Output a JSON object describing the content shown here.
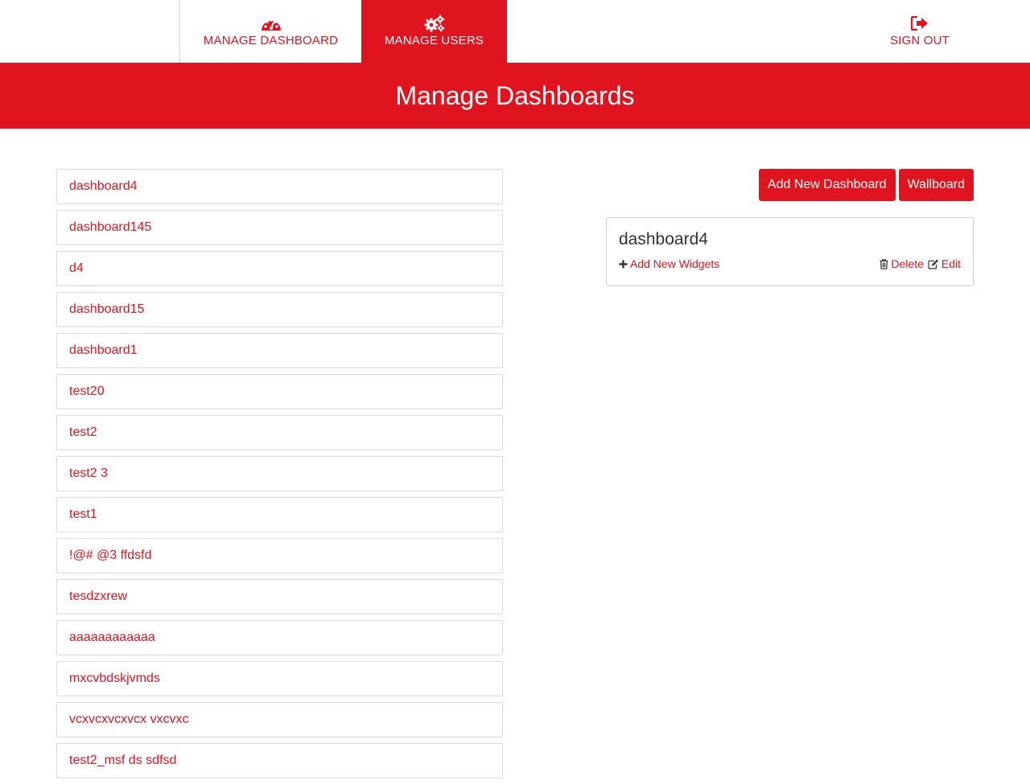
{
  "nav": {
    "manage_dashboard": "MANAGE DASHBOARD",
    "manage_users": "MANAGE USERS",
    "sign_out": "SIGN OUT"
  },
  "banner": {
    "title": "Manage Dashboards"
  },
  "dashboards": [
    "dashboard4",
    "dashboard145",
    "d4",
    "dashboard15",
    "dashboard1",
    "test20",
    "test2",
    "test2 3",
    "test1",
    "!@# @3 ffdsfd",
    "tesdzxrew",
    "aaaaaaaaaaaa",
    "mxcvbdskjvmds",
    "vcxvcxvcxvcx vxcvxc",
    "test2_msf ds sdfsd"
  ],
  "buttons": {
    "add_new": "Add New Dashboard",
    "wallboard": "Wallboard"
  },
  "panel": {
    "title": "dashboard4",
    "add_widgets": "Add New Widgets",
    "delete": "Delete",
    "edit": "Edit"
  },
  "colors": {
    "accent": "#e0141e"
  },
  "icons": {
    "manage_dashboard": "dashboard-icon",
    "manage_users": "cogs-icon",
    "sign_out": "sign-out-icon",
    "add": "plus-icon",
    "delete": "trash-icon",
    "edit": "edit-icon"
  }
}
